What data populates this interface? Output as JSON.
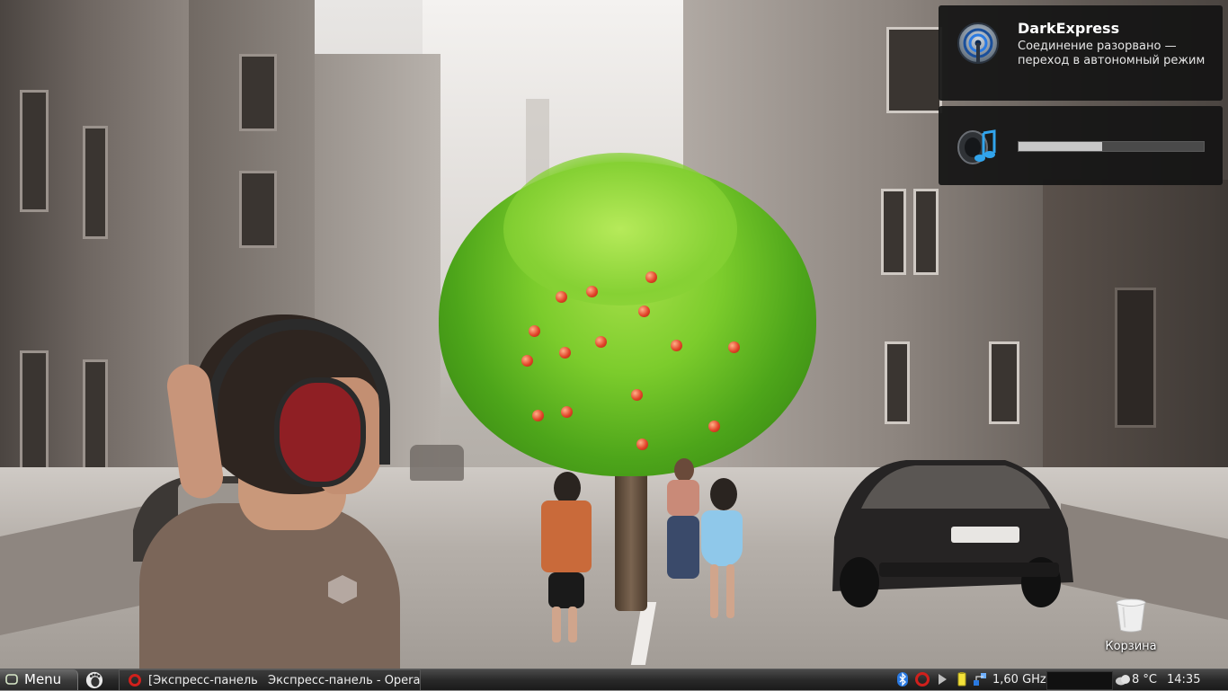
{
  "notifications": {
    "network": {
      "title": "DarkExpress",
      "body": "Соединение разорвано — переход в автономный режим",
      "icon": "network-disconnect-icon"
    },
    "volume": {
      "icon": "volume-speaker-icon",
      "level_percent": 45
    }
  },
  "desktop": {
    "icons": [
      {
        "label": "Корзина",
        "icon": "trash-icon"
      }
    ]
  },
  "panel": {
    "menu_label": "Menu",
    "taskbar": {
      "window_title_short": "[Экспресс-панель",
      "window_title_full": "Экспресс-панель - Opera"
    },
    "tray": {
      "cpu_freq": "1,60 GHz",
      "weather": "8 °C",
      "clock": "14:35"
    }
  },
  "colors": {
    "notification_bg": "#141414",
    "panel_bg": "#2a2a2a",
    "opera_red": "#d0201c",
    "bluetooth_blue": "#2a7ae2"
  }
}
